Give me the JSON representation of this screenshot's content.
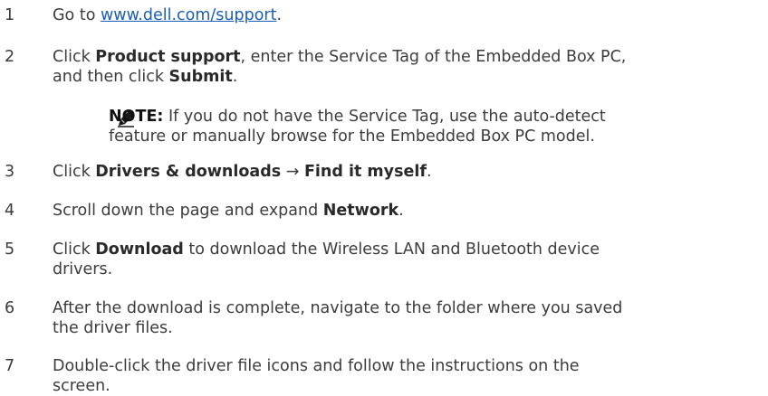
{
  "steps": [
    {
      "num": "1",
      "pre": "Go to ",
      "link": "www.dell.com/support",
      "post": "."
    },
    {
      "num": "2",
      "t1": "Click ",
      "b1": "Product support",
      "t2": ", enter the Service Tag of the Embedded Box PC,",
      "t3": "and then click ",
      "b2": "Submit",
      "t4": "."
    },
    {
      "num": "3",
      "t1": "Click ",
      "b1": "Drivers & downloads",
      "t2": " → ",
      "b2": "Find it myself",
      "t3": "."
    },
    {
      "num": "4",
      "t1": "Scroll down the page and expand ",
      "b1": "Network",
      "t2": "."
    },
    {
      "num": "5",
      "t1": "Click ",
      "b1": "Download",
      "t2": " to download the Wireless LAN and Bluetooth device",
      "t3": "drivers."
    },
    {
      "num": "6",
      "l1": "After the download is complete, navigate to the folder where you saved",
      "l2": "the driver files."
    },
    {
      "num": "7",
      "l1": "Double-click the driver file icons and follow the instructions on the",
      "l2": "screen."
    }
  ],
  "note": {
    "icon": "pencil-icon",
    "label": "NOTE:",
    "l1": " If you do not have the Service Tag, use the auto-detect",
    "l2": "feature or manually browse for the Embedded Box PC model."
  }
}
